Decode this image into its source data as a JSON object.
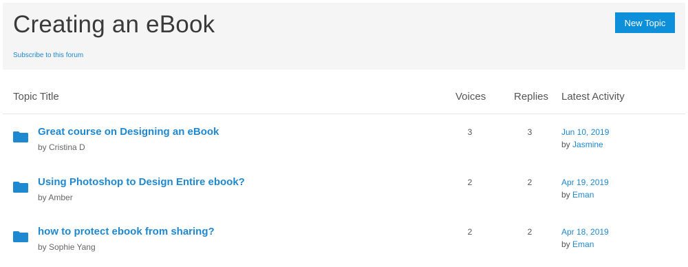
{
  "forum": {
    "title": "Creating an eBook",
    "subscribe_label": "Subscribe to this forum",
    "new_topic_label": "New Topic"
  },
  "columns": {
    "topic_title": "Topic Title",
    "voices": "Voices",
    "replies": "Replies",
    "latest_activity": "Latest Activity"
  },
  "topics": [
    {
      "icon": "folder-icon",
      "title": "Great course on Designing an eBook",
      "author": "by Cristina D",
      "voices": "3",
      "replies": "3",
      "latest_date": "Jun 10, 2019",
      "latest_by_prefix": "by",
      "latest_user": "Jasmine"
    },
    {
      "icon": "folder-icon",
      "title": "Using Photoshop to Design Entire ebook?",
      "author": "by Amber",
      "voices": "2",
      "replies": "2",
      "latest_date": "Apr 19, 2019",
      "latest_by_prefix": "by",
      "latest_user": "Eman"
    },
    {
      "icon": "folder-icon",
      "title": "how to protect ebook from sharing?",
      "author": "by Sophie Yang",
      "voices": "2",
      "replies": "2",
      "latest_date": "Apr 18, 2019",
      "latest_by_prefix": "by",
      "latest_user": "Eman"
    }
  ],
  "colors": {
    "accent": "#1e88d0",
    "button": "#0d8fd9",
    "header_bg": "#f5f5f5"
  }
}
